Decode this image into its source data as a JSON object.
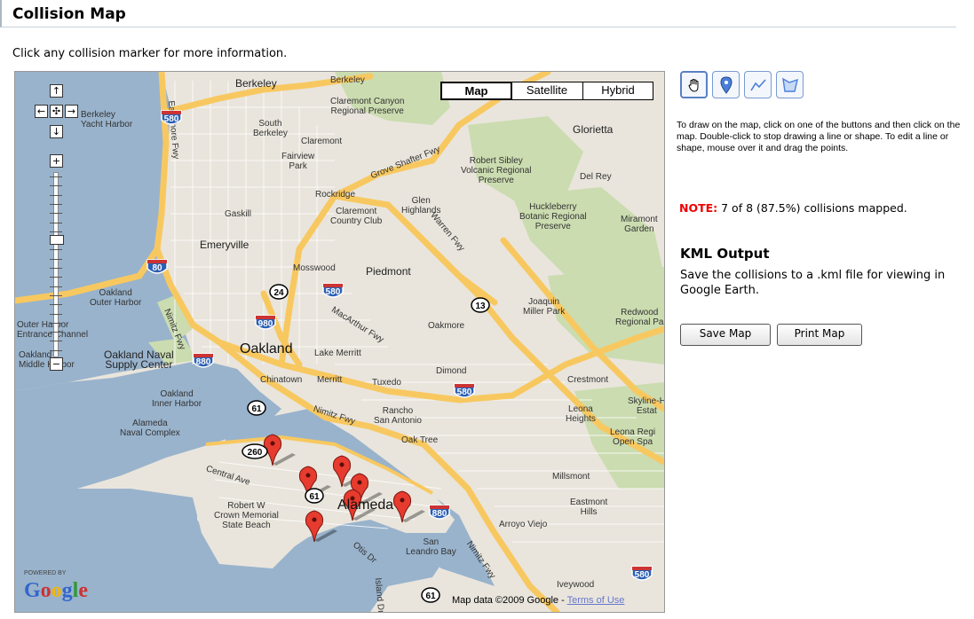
{
  "page": {
    "title": "Collision Map",
    "intro": "Click any collision marker for more information."
  },
  "map": {
    "types": {
      "map": "Map",
      "satellite": "Satellite",
      "hybrid": "Hybrid"
    },
    "nav": {
      "up": "↑",
      "left": "←",
      "center": "✣",
      "right": "→",
      "down": "↓",
      "zoom_in": "+",
      "zoom_out": "−"
    },
    "attribution": {
      "prefix": "Map data ©2009 Google - ",
      "terms": "Terms of Use"
    },
    "powered_by": "POWERED BY",
    "logo": "Google",
    "labels": {
      "berkeley": "Berkeley",
      "berkeley2": "Berkeley",
      "berkeley_yacht": "Berkeley\nYacht Harbor",
      "south_berkeley": "South\nBerkeley",
      "claremont_canyon": "Claremont Canyon\nRegional Preserve",
      "claremont": "Claremont",
      "glorietta": "Glorietta",
      "fairview_park": "Fairview\nPark",
      "robert_sibley": "Robert Sibley\nVolcanic Regional\nPreserve",
      "del_rey": "Del Rey",
      "rockridge": "Rockridge",
      "gaskill": "Gaskill",
      "claremont_cc": "Claremont\nCountry Club",
      "glen_highlands": "Glen\nHighlands",
      "huckleberry": "Huckleberry\nBotanic Regional\nPreserve",
      "miramonte": "Miramont\nGarden",
      "emeryville": "Emeryville",
      "mosswood": "Mosswood",
      "piedmont": "Piedmont",
      "oakland_outer_harbor": "Oakland\nOuter Harbor",
      "joaquin_miller": "Joaquin\nMiller Park",
      "redwood": "Redwood\nRegional Pa",
      "outer_harbor": "Outer Harbor\nEntrance Channel",
      "oakmore": "Oakmore",
      "oakland": "Oakland",
      "lake_merritt": "Lake Merritt",
      "oakland_naval": "Oakland Naval\nSupply Center",
      "oakland_middle": "Oakland\nMiddle Harbor",
      "dimond": "Dimond",
      "chinatown": "Chinatown",
      "merritt": "Merritt",
      "tuxedo": "Tuxedo",
      "crestmont": "Crestmont",
      "oakland_inner": "Oakland\nInner Harbor",
      "rancho": "Rancho\nSan Antonio",
      "leona_heights": "Leona\nHeights",
      "skyline": "Skyline-H\nEstat",
      "alameda_naval": "Alameda\nNaval Complex",
      "oak_tree": "Oak Tree",
      "leona_open": "Leona Regi\nOpen Spa",
      "central_ave": "Central Ave",
      "millsmont": "Millsmont",
      "robert_w_crown": "Robert W\nCrown Memorial\nState Beach",
      "alameda": "Alameda",
      "eastmont": "Eastmont\nHills",
      "arroyo_viejo": "Arroyo Viejo",
      "san_leandro_bay": "San\nLeandro Bay",
      "iveywood": "Iveywood",
      "eastshore": "Eastshore Fwy",
      "grove_shafter": "Grove Shafter Fwy",
      "warren": "Warren Fwy",
      "macarthur": "MacArthur Fwy",
      "nimitz": "Nimitz Fwy",
      "nimitz2": "Nimitz Fwy",
      "nimitz3": "Nimitz Fwy",
      "otis": "Otis Dr",
      "island": "Island Dr"
    },
    "shields": {
      "i580a": "580",
      "i580b": "580",
      "i580c": "580",
      "i580d": "580",
      "i80": "80",
      "i880a": "880",
      "i880b": "880",
      "i980": "980",
      "ca24": "24",
      "ca13": "13",
      "ca61a": "61",
      "ca61b": "61",
      "ca61c": "61",
      "ca260": "260"
    },
    "markers_count": 7
  },
  "tools": {
    "hand": "hand-icon",
    "marker": "placemark-icon",
    "line": "polyline-icon",
    "shape": "polygon-icon"
  },
  "help_text": "To draw on the map, click on one of the buttons and then click on the map. Double-click to stop drawing a line or shape. To edit a line or shape, mouse over it and drag the points.",
  "note": {
    "label": "NOTE:",
    "text": " 7 of 8 (87.5%) collisions mapped."
  },
  "kml": {
    "title": "KML Output",
    "text": "Save the collisions to a .kml file for viewing in Google Earth."
  },
  "buttons": {
    "save": "Save Map",
    "print": "Print Map"
  },
  "colors": {
    "freeway": "#f8c860",
    "land": "#e9e5dc",
    "water": "#99b3cc",
    "park": "#cbdcb0",
    "marker": "#e63b2e",
    "note": "#ee0000"
  }
}
